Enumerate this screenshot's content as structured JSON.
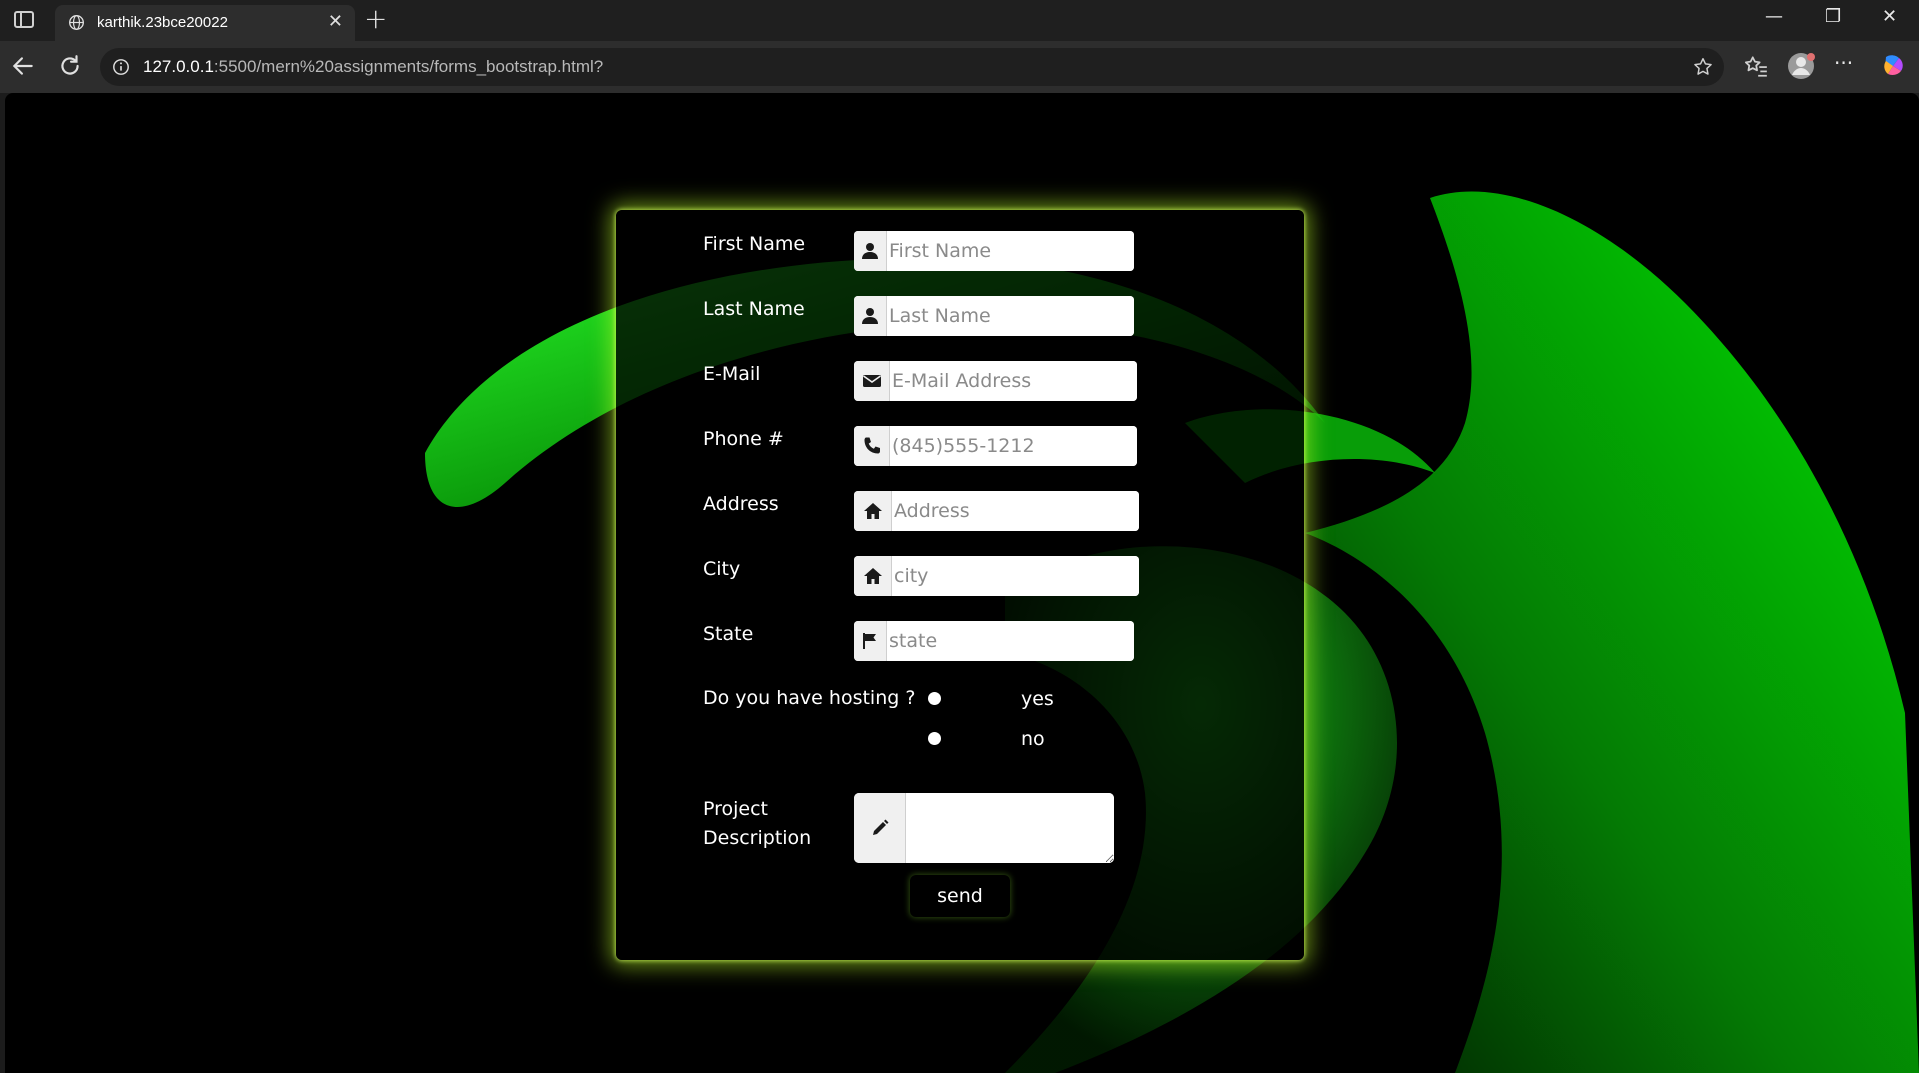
{
  "browser": {
    "tab_title": "karthik.23bce20022",
    "tab_close": "✕",
    "new_tab": "+",
    "url_host": "127.0.0.1",
    "url_rest": ":5500/mern%20assignments/forms_bootstrap.html?",
    "window_minimize": "—",
    "window_restore": "❐",
    "window_close": "✕",
    "more_menu": "···"
  },
  "form": {
    "first_name": {
      "label": "First Name",
      "placeholder": "First Name",
      "icon": "user-icon"
    },
    "last_name": {
      "label": "Last Name",
      "placeholder": "Last Name",
      "icon": "user-icon"
    },
    "email": {
      "label": "E-Mail",
      "placeholder": "E-Mail Address",
      "icon": "envelope-icon"
    },
    "phone": {
      "label": "Phone #",
      "placeholder": "(845)555-1212",
      "icon": "phone-icon"
    },
    "address": {
      "label": "Address",
      "placeholder": "Address",
      "icon": "home-icon"
    },
    "city": {
      "label": "City",
      "placeholder": "city",
      "icon": "home-icon"
    },
    "state": {
      "label": "State",
      "placeholder": "state",
      "icon": "flag-icon"
    },
    "hosting": {
      "label": "Do you have hosting ?",
      "options": [
        "yes",
        "no"
      ]
    },
    "project": {
      "label_line1": "Project",
      "label_line2": "Description",
      "icon": "pencil-icon"
    },
    "send_label": "send"
  },
  "colors": {
    "glow": "#bfff28",
    "background": "#000000",
    "accent_green": "#1fd11f"
  }
}
